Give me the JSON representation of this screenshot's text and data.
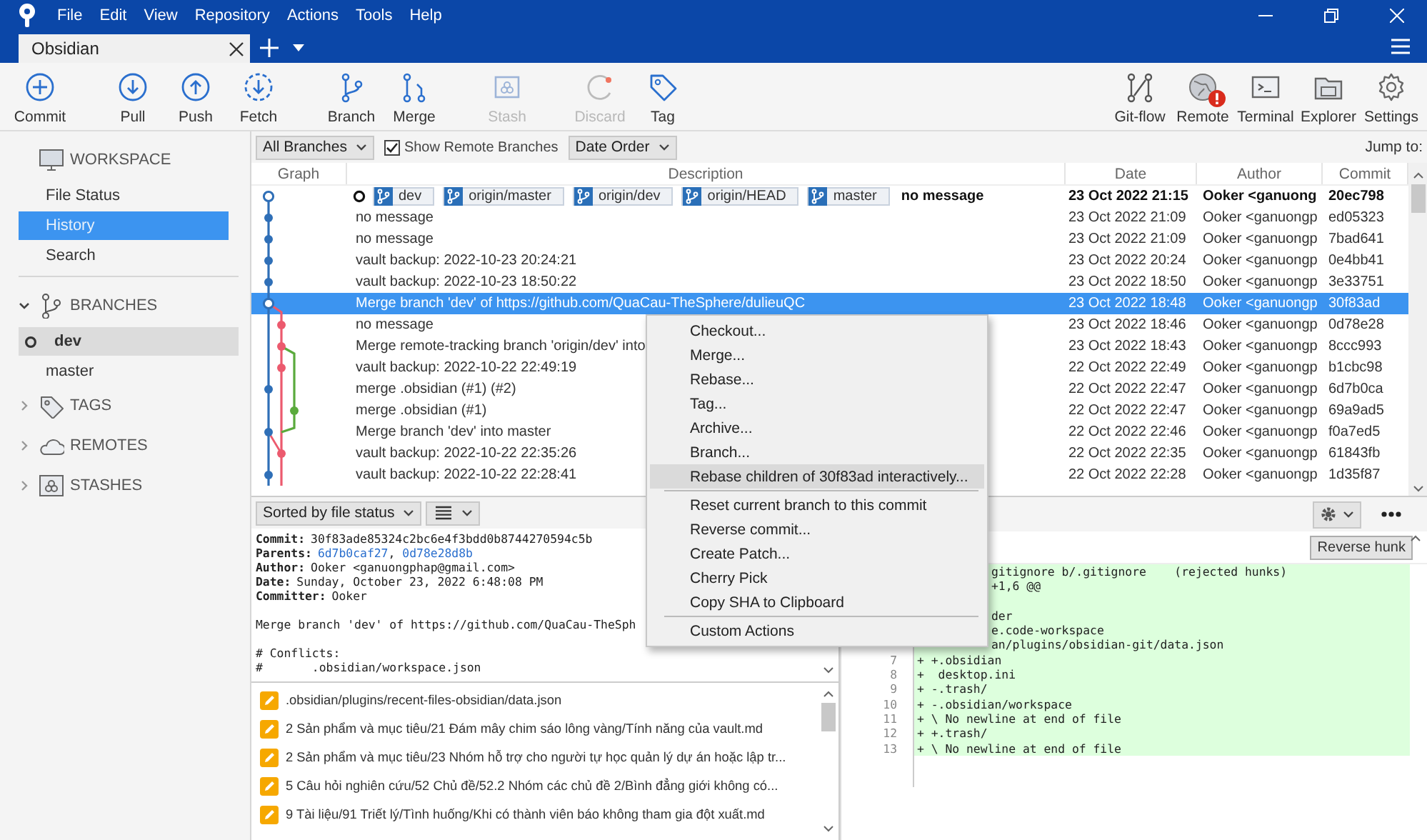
{
  "window": {
    "menu": [
      "File",
      "Edit",
      "View",
      "Repository",
      "Actions",
      "Tools",
      "Help"
    ]
  },
  "tabs": [
    {
      "label": "Obsidian",
      "selected": true
    }
  ],
  "toolbar": {
    "left_groups": [
      [
        {
          "label": "Commit",
          "kind": "commit",
          "disabled": false
        }
      ],
      [
        {
          "label": "Pull",
          "kind": "pull",
          "disabled": false
        },
        {
          "label": "Push",
          "kind": "push",
          "disabled": false
        },
        {
          "label": "Fetch",
          "kind": "fetch",
          "disabled": false
        }
      ],
      [
        {
          "label": "Branch",
          "kind": "branch",
          "disabled": false
        },
        {
          "label": "Merge",
          "kind": "merge",
          "disabled": false
        }
      ],
      [
        {
          "label": "Stash",
          "kind": "stash",
          "disabled": true
        }
      ],
      [
        {
          "label": "Discard",
          "kind": "discard",
          "disabled": true
        },
        {
          "label": "Tag",
          "kind": "tag",
          "disabled": false
        }
      ]
    ],
    "right": [
      {
        "label": "Git-flow",
        "kind": "gitflow",
        "disabled": false,
        "alert": false
      },
      {
        "label": "Remote",
        "kind": "remote",
        "disabled": false,
        "alert": true
      },
      {
        "label": "Terminal",
        "kind": "terminal",
        "disabled": false,
        "alert": false
      },
      {
        "label": "Explorer",
        "kind": "explorer",
        "disabled": false,
        "alert": false
      },
      {
        "label": "Settings",
        "kind": "settings",
        "disabled": false,
        "alert": false
      }
    ]
  },
  "sidebar": {
    "sections": [
      {
        "title": "WORKSPACE",
        "kind": "monitor",
        "expanded": true,
        "items": [
          {
            "label": "File Status",
            "selected": false,
            "current": false
          },
          {
            "label": "History",
            "selected": true,
            "current": false
          },
          {
            "label": "Search",
            "selected": false,
            "current": false
          }
        ]
      },
      {
        "title": "BRANCHES",
        "kind": "branch",
        "expanded": true,
        "items": [
          {
            "label": "dev",
            "selected": false,
            "current": true
          },
          {
            "label": "master",
            "selected": false,
            "current": false
          }
        ]
      },
      {
        "title": "TAGS",
        "kind": "tag",
        "expanded": false
      },
      {
        "title": "REMOTES",
        "kind": "cloud",
        "expanded": false
      },
      {
        "title": "STASHES",
        "kind": "stash",
        "expanded": false
      }
    ]
  },
  "filter_bar": {
    "branches": "All Branches",
    "show_remote": {
      "label": "Show Remote Branches",
      "checked": true
    },
    "order": "Date Order",
    "jump_label": "Jump to:"
  },
  "table": {
    "columns": [
      "Graph",
      "Description",
      "Date",
      "Author",
      "Commit"
    ],
    "rows": [
      {
        "description": "no message",
        "refs": [
          "dev",
          "origin/master",
          "origin/dev",
          "origin/HEAD",
          "master"
        ],
        "date": "23 Oct 2022 21:15",
        "author": "Ooker <ganuong",
        "commit": "20ec798",
        "current": true,
        "selected": false
      },
      {
        "description": "no message",
        "date": "23 Oct 2022 21:09",
        "author": "Ooker <ganuongp",
        "commit": "ed05323",
        "current": false,
        "selected": false
      },
      {
        "description": "no message",
        "date": "23 Oct 2022 21:09",
        "author": "Ooker <ganuongp",
        "commit": "7bad641",
        "current": false,
        "selected": false
      },
      {
        "description": "vault backup: 2022-10-23 20:24:21",
        "date": "23 Oct 2022 20:24",
        "author": "Ooker <ganuongp",
        "commit": "0e4bb41",
        "current": false,
        "selected": false
      },
      {
        "description": "vault backup: 2022-10-23 18:50:22",
        "date": "23 Oct 2022 18:50",
        "author": "Ooker <ganuongp",
        "commit": "3e33751",
        "current": false,
        "selected": false
      },
      {
        "description": "Merge branch 'dev' of https://github.com/QuaCau-TheSphere/dulieuQC",
        "date": "23 Oct 2022 18:48",
        "author": "Ooker <ganuongp",
        "commit": "30f83ad",
        "current": false,
        "selected": true
      },
      {
        "description": "no message",
        "date": "23 Oct 2022 18:46",
        "author": "Ooker <ganuongp",
        "commit": "0d78e28",
        "current": false,
        "selected": false
      },
      {
        "description": "Merge remote-tracking branch 'origin/dev' into",
        "date": "23 Oct 2022 18:43",
        "author": "Ooker <ganuongp",
        "commit": "8ccc993",
        "current": false,
        "selected": false
      },
      {
        "description": "vault backup: 2022-10-22 22:49:19",
        "date": "22 Oct 2022 22:49",
        "author": "Ooker <ganuongp",
        "commit": "b1cbc98",
        "current": false,
        "selected": false
      },
      {
        "description": "merge .obsidian (#1) (#2)",
        "date": "22 Oct 2022 22:47",
        "author": "Ooker <ganuongp",
        "commit": "6d7b0ca",
        "current": false,
        "selected": false
      },
      {
        "description": "merge .obsidian (#1)",
        "date": "22 Oct 2022 22:47",
        "author": "Ooker <ganuongp",
        "commit": "69a9ad5",
        "current": false,
        "selected": false
      },
      {
        "description": "Merge branch 'dev' into master",
        "date": "22 Oct 2022 22:46",
        "author": "Ooker <ganuongp",
        "commit": "f0a7ed5",
        "current": false,
        "selected": false
      },
      {
        "description": "vault backup: 2022-10-22 22:35:26",
        "date": "22 Oct 2022 22:35",
        "author": "Ooker <ganuongp",
        "commit": "61843fb",
        "current": false,
        "selected": false
      },
      {
        "description": "vault backup: 2022-10-22 22:28:41",
        "date": "22 Oct 2022 22:28",
        "author": "Ooker <ganuongp",
        "commit": "1d35f87",
        "current": false,
        "selected": false
      }
    ]
  },
  "context_menu": {
    "groups": [
      [
        {
          "label": "Checkout...",
          "selected": false
        },
        {
          "label": "Merge...",
          "selected": false
        },
        {
          "label": "Rebase...",
          "selected": false
        },
        {
          "label": "Tag...",
          "selected": false
        },
        {
          "label": "Archive...",
          "selected": false
        },
        {
          "label": "Branch...",
          "selected": false
        },
        {
          "label": "Rebase children of 30f83ad interactively...",
          "selected": true
        }
      ],
      [
        {
          "label": "Reset current branch to this commit",
          "selected": false
        },
        {
          "label": "Reverse commit...",
          "selected": false
        },
        {
          "label": "Create Patch...",
          "selected": false
        },
        {
          "label": "Cherry Pick",
          "selected": false
        },
        {
          "label": "Copy SHA to Clipboard",
          "selected": false
        }
      ],
      [
        {
          "label": "Custom Actions",
          "selected": false
        }
      ]
    ]
  },
  "file_pane": {
    "sort": "Sorted by file status",
    "details": [
      {
        "label": "Commit:",
        "value": "30f83ade85324c2bc6e4f3bdd0b8744270594c5b"
      },
      {
        "label": "Parents:",
        "links": [
          "6d7b0caf27",
          "0d78e28d8b"
        ],
        "separator": ","
      },
      {
        "label": "Author:",
        "value": "Ooker <ganuongphap@gmail.com>"
      },
      {
        "label": "Date:",
        "value": "Sunday, October 23, 2022 6:48:08 PM"
      },
      {
        "label": "Committer:",
        "value": "Ooker"
      }
    ],
    "message": [
      "Merge branch 'dev' of https://github.com/QuaCau-TheSph",
      "# Conflicts:",
      "#       .obsidian/workspace.json"
    ],
    "files": [
      {
        "path": ".obsidian/plugins/recent-files-obsidian/data.json",
        "kind": "modified"
      },
      {
        "path": "2 Sản phẩm và mục tiêu/21 Đám mây chim sáo lông vàng/Tính năng của vault.md",
        "kind": "modified"
      },
      {
        "path": "2 Sản phẩm và mục tiêu/23 Nhóm hỗ trợ cho người tự học quản lý dự án hoặc lập tr...",
        "kind": "modified"
      },
      {
        "path": "5 Câu hỏi nghiên cứu/52 Chủ đề/52.2 Nhóm các chủ đề 2/Bình đẳng giới không có...",
        "kind": "modified"
      },
      {
        "path": "9 Tài liệu/91 Triết lý/Tình huống/Khi có thành viên báo không tham gia đột xuất.md",
        "kind": "modified"
      }
    ]
  },
  "diff_pane": {
    "reverse_button": "Reverse hunk",
    "lines": [
      {
        "kind": "clipped",
        "text": "gitignore b/.gitignore    (rejected hunks)"
      },
      {
        "kind": "clipped",
        "text": "+1,6 @@"
      },
      {
        "kind": "clipped"
      },
      {
        "kind": "clipped",
        "text": "der"
      },
      {
        "kind": "clipped",
        "text": "e.code-workspace"
      },
      {
        "kind": "clipped",
        "text": "an/plugins/obsidian-git/data.json"
      },
      {
        "kind": "added",
        "number": "7",
        "text": "+ +.obsidian"
      },
      {
        "kind": "added",
        "number": "8",
        "text": "+  desktop.ini"
      },
      {
        "kind": "added",
        "number": "9",
        "text": "+ -.trash/"
      },
      {
        "kind": "added",
        "number": "10",
        "text": "+ -.obsidian/workspace"
      },
      {
        "kind": "added",
        "number": "11",
        "text": "+ \\ No newline at end of file"
      },
      {
        "kind": "added",
        "number": "12",
        "text": "+ +.trash/"
      },
      {
        "kind": "added",
        "number": "13",
        "text": "+ \\ No newline at end of file"
      }
    ]
  }
}
